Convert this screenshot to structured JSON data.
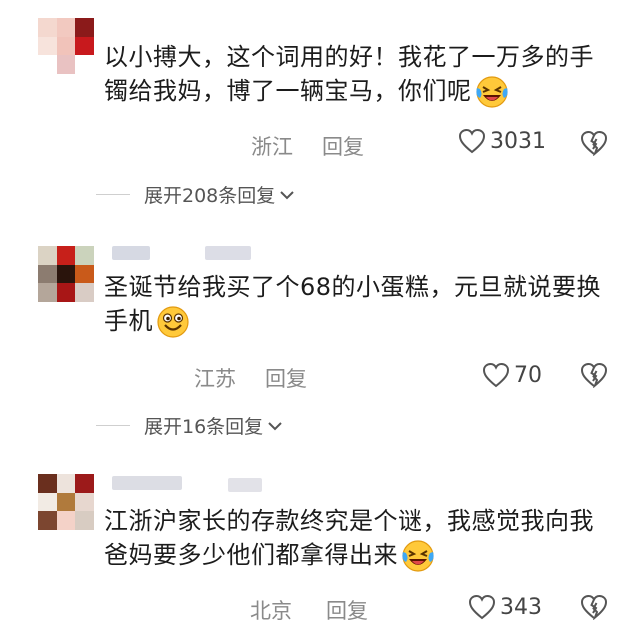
{
  "comments": [
    {
      "text_line1": "以小搏大，这个词用的好！我花了一万多的手",
      "text_line2": "镯给我妈，博了一辆宝马，你们呢",
      "emoji": "laughing-crying-emoji",
      "location": "浙江",
      "reply_label": "回复",
      "likes": "3031",
      "expand_label": "展开208条回复"
    },
    {
      "text_line1": "圣诞节给我买了个68的小蛋糕，元旦就说要换",
      "text_line2": "手机",
      "emoji": "grinning-emoji",
      "location": "江苏",
      "reply_label": "回复",
      "likes": "70",
      "expand_label": "展开16条回复"
    },
    {
      "text_line1": "江浙沪家长的存款终究是个谜，我感觉我向我",
      "text_line2": "爸妈要多少他们都拿得出来",
      "emoji": "laughing-crying-emoji",
      "location": "北京",
      "reply_label": "回复",
      "likes": "343"
    }
  ],
  "colors": {
    "meta": "#8a8a8a",
    "text": "#1c1c1c",
    "emoji_face": "#ffc93a"
  }
}
